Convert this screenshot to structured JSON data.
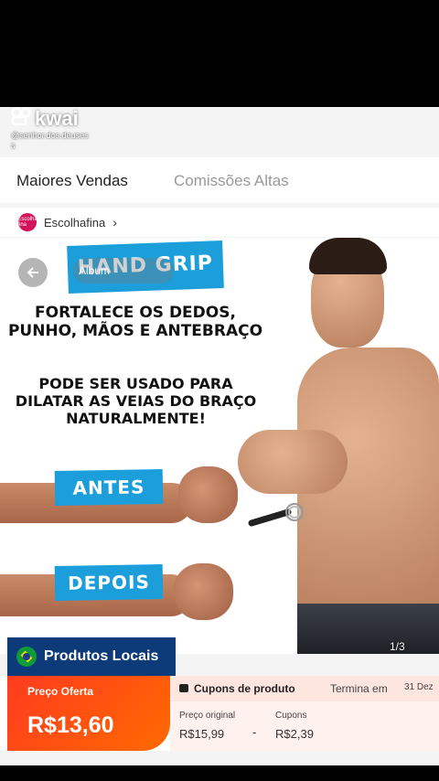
{
  "watermark": {
    "brand": "kwai",
    "username": "@senhor.dos.deuses",
    "username_tail": "s"
  },
  "tabs": {
    "active": "Maiores Vendas",
    "inactive": "Comissões Altas"
  },
  "store": {
    "name": "Escolhafina",
    "logo_text": "Escolha fina"
  },
  "product_image": {
    "banner_title": "HAND GRIP",
    "album_chip": "Álbum",
    "headline": "FORTALECE OS DEDOS, PUNHO, MÃOS E ANTEBRAÇO",
    "subline": "PODE SER USADO PARA DILATAR AS VEIAS DO BRAÇO NATURALMENTE!",
    "before_label": "ANTES",
    "after_label": "DEPOIS",
    "pager": "1/3"
  },
  "badge": {
    "label": "Produtos Locais"
  },
  "price": {
    "offer_label": "Preço Oferta",
    "offer_value": "R$13,60",
    "coupon_title": "Cupons de produto",
    "ends_label": "Termina em",
    "ends_date": "31 Dez",
    "original_label": "Preço original",
    "original_value": "R$15,99",
    "coupons_label": "Cupons",
    "coupons_value": "R$2,39",
    "minus": "-"
  },
  "colors": {
    "accent_orange": "#ff4a1a",
    "banner_blue": "#1b9ed9",
    "badge_navy": "#0d3b7a"
  }
}
